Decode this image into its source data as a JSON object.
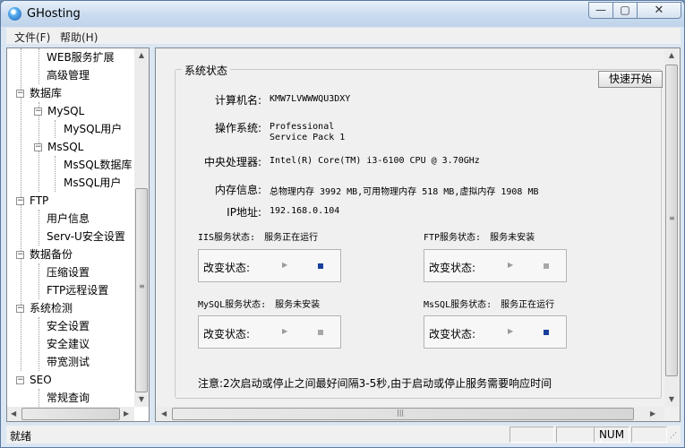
{
  "window": {
    "title": "GHosting",
    "controls": {
      "minimize": "—",
      "maximize": "▢",
      "close": "✕"
    }
  },
  "menu": {
    "items": [
      "文件(F)",
      "帮助(H)"
    ]
  },
  "tree": {
    "items": [
      {
        "label": "WEB服务扩展",
        "level": 2
      },
      {
        "label": "高级管理",
        "level": 2
      },
      {
        "label": "数据库",
        "level": 0,
        "expander": "−"
      },
      {
        "label": "MySQL",
        "level": 1,
        "expander": "−"
      },
      {
        "label": "MySQL用户",
        "level": 2
      },
      {
        "label": "MsSQL",
        "level": 1,
        "expander": "−"
      },
      {
        "label": "MsSQL数据库",
        "level": 2
      },
      {
        "label": "MsSQL用户",
        "level": 2
      },
      {
        "label": "FTP",
        "level": 0,
        "expander": "−"
      },
      {
        "label": "用户信息",
        "level": 1
      },
      {
        "label": "Serv-U安全设置",
        "level": 1
      },
      {
        "label": "数据备份",
        "level": 0,
        "expander": "−"
      },
      {
        "label": "压缩设置",
        "level": 1
      },
      {
        "label": "FTP远程设置",
        "level": 1
      },
      {
        "label": "系统检测",
        "level": 0,
        "expander": "−"
      },
      {
        "label": "安全设置",
        "level": 1
      },
      {
        "label": "安全建议",
        "level": 1
      },
      {
        "label": "带宽测试",
        "level": 1
      },
      {
        "label": "SEO",
        "level": 0,
        "expander": "−"
      },
      {
        "label": "常规查询",
        "level": 1
      }
    ]
  },
  "panel": {
    "group_title": "系统状态",
    "quick_start_label": "快速开始",
    "computer_name_label": "计算机名:",
    "computer_name": "KMW7LVWWWQU3DXY",
    "os_label": "操作系统:",
    "os_line1": "Professional",
    "os_line2": "Service Pack 1",
    "cpu_label": "中央处理器:",
    "cpu": "Intel(R) Core(TM) i3-6100 CPU @ 3.70GHz",
    "memory_label": "内存信息:",
    "memory": "总物理内存 3992 MB,可用物理内存 518 MB,虚拟内存 1908 MB",
    "ip_label": "IP地址:",
    "ip": "192.168.0.104",
    "services": [
      {
        "label": "IIS服务状态:",
        "status": "服务正在运行",
        "change_label": "改变状态:",
        "running": true
      },
      {
        "label": "FTP服务状态:",
        "status": "服务未安装",
        "change_label": "改变状态:",
        "running": false
      },
      {
        "label": "MySQL服务状态:",
        "status": "服务未安装",
        "change_label": "改变状态:",
        "running": false
      },
      {
        "label": "MsSQL服务状态:",
        "status": "服务正在运行",
        "change_label": "改变状态:",
        "running": true
      }
    ],
    "note": "注意:2次启动或停止之间最好间隔3-5秒,由于启动或停止服务需要响应时间"
  },
  "statusbar": {
    "text": "就绪",
    "num": "NUM"
  },
  "colors": {
    "active_stop": "#1a3f9c",
    "inactive_stop": "#a8a8a8",
    "window_bg": "#dbe6f3"
  }
}
